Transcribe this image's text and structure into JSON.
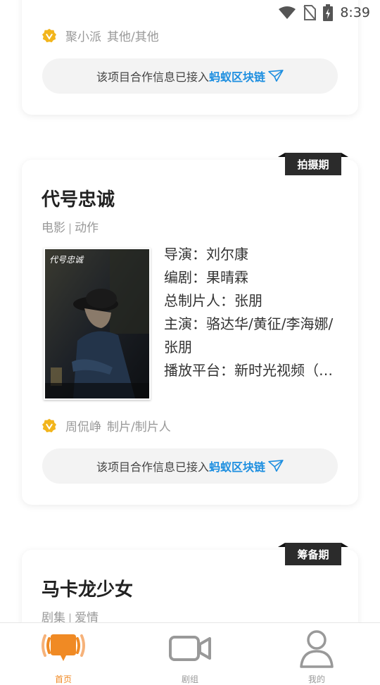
{
  "status_bar": {
    "time": "8:39"
  },
  "cards": [
    {
      "uploader": {
        "name": "聚小派",
        "role": "其他/其他"
      },
      "chain": {
        "prefix": "该项目合作信息已接入",
        "link": "蚂蚁区块链"
      }
    },
    {
      "stage": "拍摄期",
      "title": "代号忠诚",
      "category": "电影",
      "genre": "动作",
      "poster_caption": "代号忠诚",
      "info": {
        "director": "导演：刘尔康",
        "writer": "编剧：果晴霖",
        "producer": "总制片人：张朋",
        "cast": "主演：骆达华/黄征/李海娜/张朋",
        "platform": "播放平台：新时光视频（…"
      },
      "uploader": {
        "name": "周侃峥",
        "role": "制片/制片人"
      },
      "chain": {
        "prefix": "该项目合作信息已接入",
        "link": "蚂蚁区块链"
      }
    },
    {
      "stage": "筹备期",
      "title": "马卡龙少女",
      "category": "剧集",
      "genre": "爱情"
    }
  ],
  "tabs": [
    {
      "label": "首页",
      "icon": "chat-bubble-icon",
      "active": true
    },
    {
      "label": "剧组",
      "icon": "video-camera-icon",
      "active": false
    },
    {
      "label": "我的",
      "icon": "person-icon",
      "active": false
    }
  ],
  "colors": {
    "accent": "#f08a24",
    "link": "#1e8fe0",
    "ribbon": "#2b2b2b",
    "badge": "#f2b51c"
  }
}
